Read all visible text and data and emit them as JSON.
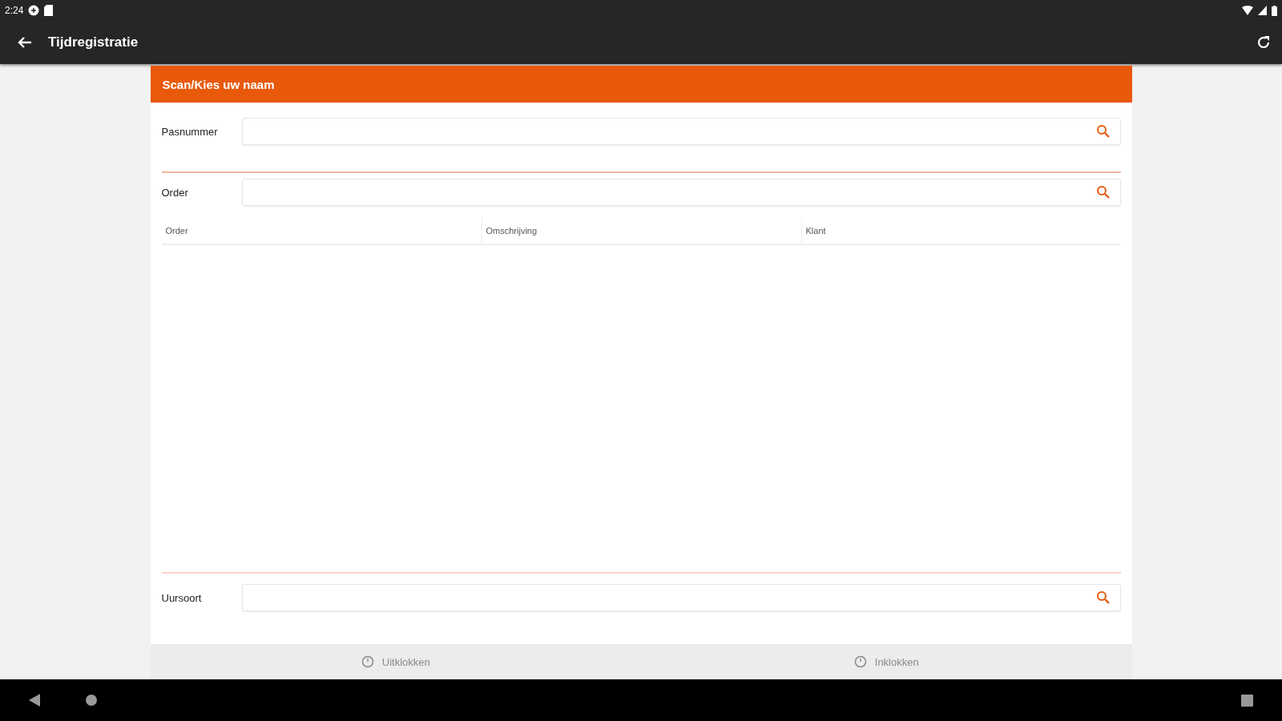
{
  "status_bar": {
    "time": "2:24"
  },
  "app_bar": {
    "title": "Tijdregistratie"
  },
  "card": {
    "header": "Scan/Kies uw naam",
    "fields": [
      {
        "label": "Pasnummer"
      },
      {
        "label": "Order"
      }
    ],
    "table": {
      "columns": [
        "Order",
        "Omschrijving",
        "Klant"
      ]
    },
    "bottom_field": {
      "label": "Uursoort"
    },
    "buttons": [
      {
        "label": "Uitklokken",
        "disabled": true
      },
      {
        "label": "Inklokken",
        "disabled": true
      }
    ]
  }
}
